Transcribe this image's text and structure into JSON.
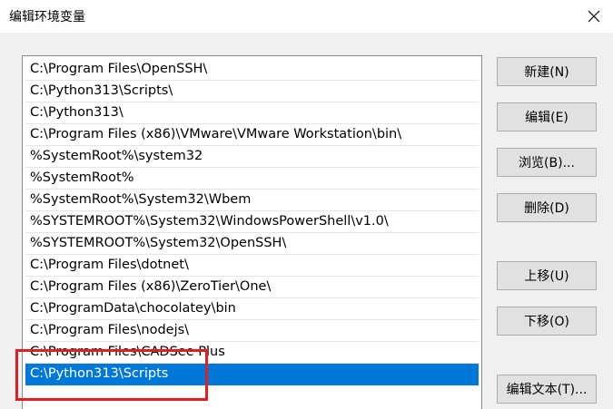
{
  "window": {
    "title": "编辑环境变量",
    "close_icon": "close-icon"
  },
  "path_list": {
    "items": [
      "C:\\Program Files\\OpenSSH\\",
      "C:\\Python313\\Scripts\\",
      "C:\\Python313\\",
      "C:\\Program Files (x86)\\VMware\\VMware Workstation\\bin\\",
      "%SystemRoot%\\system32",
      "%SystemRoot%",
      "%SystemRoot%\\System32\\Wbem",
      "%SYSTEMROOT%\\System32\\WindowsPowerShell\\v1.0\\",
      "%SYSTEMROOT%\\System32\\OpenSSH\\",
      "C:\\Program Files\\dotnet\\",
      "C:\\Program Files (x86)\\ZeroTier\\One\\",
      "C:\\ProgramData\\chocolatey\\bin",
      "C:\\Program Files\\nodejs\\",
      "C:\\Program Files\\CADSee Plus",
      "C:\\Python313\\Scripts"
    ],
    "selected_index": 14
  },
  "buttons": {
    "new": "新建(N)",
    "edit": "编辑(E)",
    "browse": "浏览(B)...",
    "delete": "删除(D)",
    "move_up": "上移(U)",
    "move_down": "下移(O)",
    "edit_text": "编辑文本(T)..."
  },
  "colors": {
    "selection": "#0078d7",
    "annotation_box": "#e02020"
  }
}
